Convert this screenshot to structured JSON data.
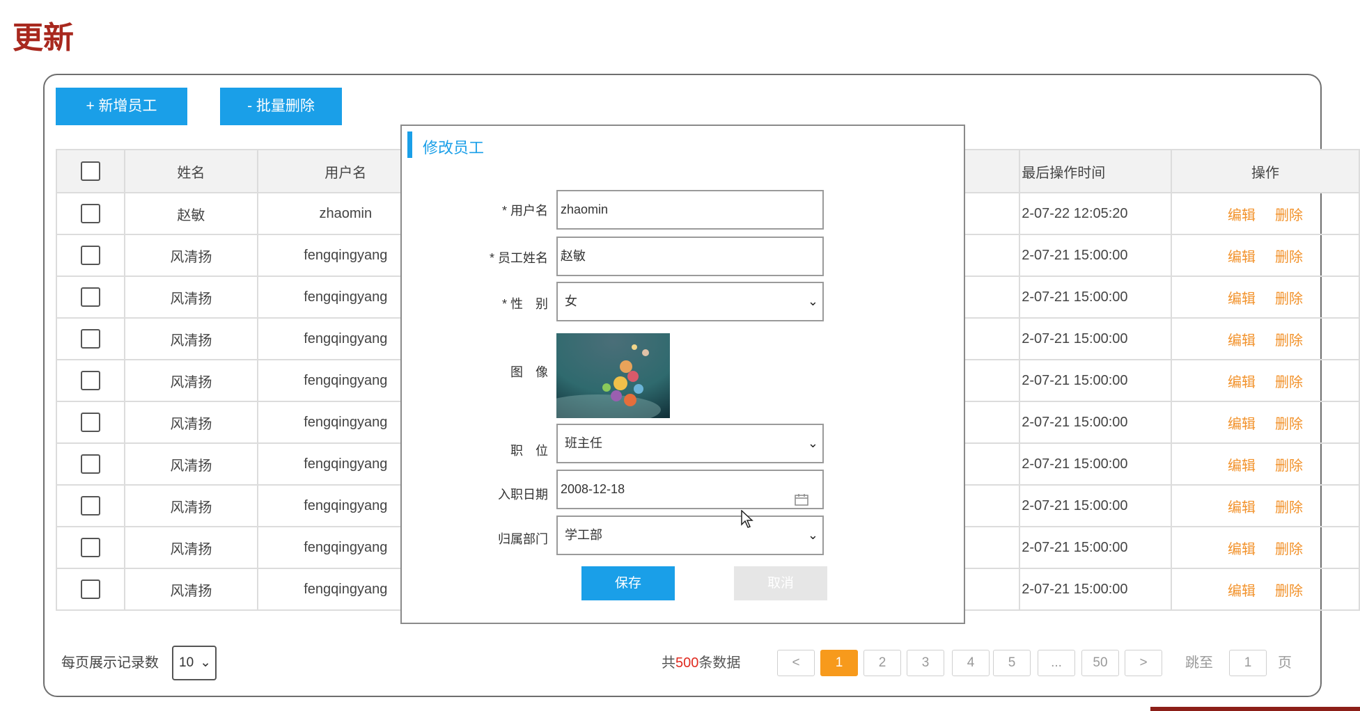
{
  "page": {
    "title": "更新"
  },
  "toolbar": {
    "add_label": "+ 新增员工",
    "batch_delete_label": "- 批量删除"
  },
  "table": {
    "headers": {
      "name": "姓名",
      "username": "用户名",
      "last_op_time": "最后操作时间",
      "actions": "操作"
    },
    "action_edit": "编辑",
    "action_delete": "删除",
    "rows": [
      {
        "name": "赵敏",
        "username": "zhaomin",
        "time": "2-07-22 12:05:20"
      },
      {
        "name": "风清扬",
        "username": "fengqingyang",
        "time": "2-07-21 15:00:00"
      },
      {
        "name": "风清扬",
        "username": "fengqingyang",
        "time": "2-07-21 15:00:00"
      },
      {
        "name": "风清扬",
        "username": "fengqingyang",
        "time": "2-07-21 15:00:00"
      },
      {
        "name": "风清扬",
        "username": "fengqingyang",
        "time": "2-07-21 15:00:00"
      },
      {
        "name": "风清扬",
        "username": "fengqingyang",
        "time": "2-07-21 15:00:00"
      },
      {
        "name": "风清扬",
        "username": "fengqingyang",
        "time": "2-07-21 15:00:00"
      },
      {
        "name": "风清扬",
        "username": "fengqingyang",
        "time": "2-07-21 15:00:00"
      },
      {
        "name": "风清扬",
        "username": "fengqingyang",
        "time": "2-07-21 15:00:00"
      },
      {
        "name": "风清扬",
        "username": "fengqingyang",
        "time": "2-07-21 15:00:00"
      }
    ]
  },
  "footer": {
    "per_page_label": "每页展示记录数",
    "per_page_value": "10",
    "total_prefix": "共",
    "total_count": "500",
    "total_suffix": "条数据",
    "prev": "<",
    "pages": [
      "1",
      "2",
      "3",
      "4",
      "5",
      "...",
      "50"
    ],
    "next": ">",
    "jump_label": "跳至",
    "jump_value": "1",
    "page_unit": "页"
  },
  "modal": {
    "title": "修改员工",
    "username_label": "* 用户名",
    "username_value": "zhaomin",
    "name_label": "* 员工姓名",
    "name_value": "赵敏",
    "gender_label": "* 性　别",
    "gender_value": "女",
    "image_label": "图　像",
    "position_label": "职　位",
    "position_value": "班主任",
    "entry_date_label": "入职日期",
    "entry_date_value": "2008-12-18",
    "dept_label": "归属部门",
    "dept_value": "学工部",
    "save_label": "保存",
    "cancel_label": "取消"
  },
  "colors": {
    "primary": "#1a9fe8",
    "accent": "#f79a1c",
    "title": "#a8281e",
    "action": "#f2922b"
  },
  "icons": {
    "calendar": "calendar-icon",
    "dropdown": "chevron-down-icon",
    "cursor": "mouse-cursor-icon"
  }
}
